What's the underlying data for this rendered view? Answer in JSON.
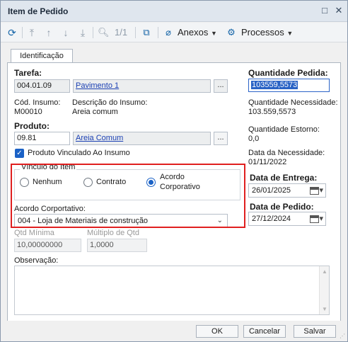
{
  "window": {
    "title": "Item de Pedido"
  },
  "toolbar": {
    "pager": "1/1",
    "attachments_label": "Anexos",
    "processes_label": "Processos"
  },
  "tabs": [
    {
      "label": "Identificação"
    }
  ],
  "form": {
    "tarefa": {
      "label": "Tarefa:",
      "code": "004.01.09",
      "name": "Pavimento 1"
    },
    "insumo": {
      "code_label": "Cód. Insumo:",
      "code": "M00010",
      "desc_label": "Descrição do Insumo:",
      "desc": "Areia comum"
    },
    "produto": {
      "label": "Produto:",
      "code": "09.81",
      "name": "Areia Comum"
    },
    "vinculado": {
      "label": "Produto Vinculado Ao Insumo",
      "checked": true
    },
    "vinculo": {
      "title": "Vínculo do Item",
      "options": [
        {
          "label": "Nenhum",
          "selected": false
        },
        {
          "label": "Contrato",
          "selected": false
        },
        {
          "label": "Acordo Corporativo",
          "line1": "Acordo",
          "line2": "Corporativo",
          "selected": true
        }
      ]
    },
    "acordo": {
      "label": "Acordo Corportativo:",
      "value": "004 - Loja de Materiais de construção"
    },
    "qtd_minima": {
      "label": "Qtd Mínima",
      "value": "10,00000000"
    },
    "multiplo": {
      "label": "Múltiplo de Qtd",
      "value": "1,0000"
    },
    "observacao": {
      "label": "Observação:",
      "value": ""
    }
  },
  "right": {
    "qtd_pedida": {
      "label": "Quantidade Pedida:",
      "value": "103559,5573"
    },
    "qtd_necessidade": {
      "label": "Quantidade Necessidade:",
      "value": "103.559,5573"
    },
    "qtd_estorno": {
      "label": "Quantidade Estorno:",
      "value": "0,0"
    },
    "data_necessidade": {
      "label": "Data da Necessidade:",
      "value": "01/11/2022"
    },
    "data_entrega": {
      "label": "Data de Entrega:",
      "value": "26/01/2025"
    },
    "data_pedido": {
      "label": "Data de Pedido:",
      "value": "27/12/2024"
    }
  },
  "footer": {
    "ok": "OK",
    "cancel": "Cancelar",
    "save": "Salvar"
  },
  "colors": {
    "accent": "#1b62c6",
    "highlight_border": "#e01f1f",
    "link": "#1a3fb3"
  }
}
